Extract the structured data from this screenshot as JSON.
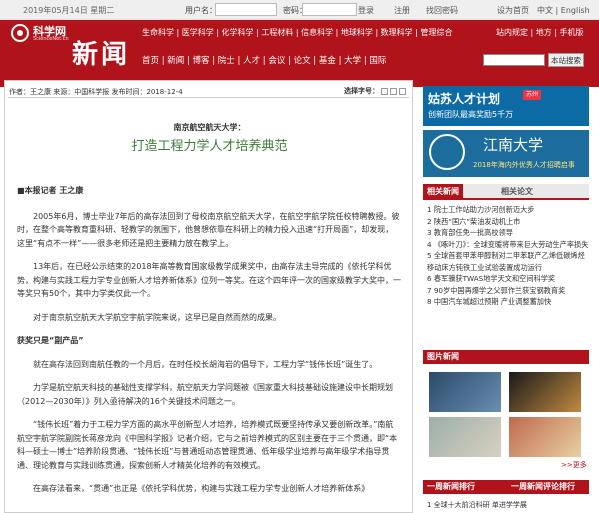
{
  "topbar": {
    "date": "2019年05月14日 星期二",
    "username_label": "用户名：",
    "password_label": "密码：",
    "login": "登录",
    "register": "注册",
    "forgot": "找回密码",
    "set_home": "设为首页",
    "lang": "中文 | English"
  },
  "header": {
    "logo_cn": "科学网",
    "logo_en": "ScienceNet.cn",
    "section": "新闻",
    "nav_top": "生命科学 | 医学科学 | 化学科学 | 工程材料 | 信息科学 | 地球科学 | 数理科学 | 管理综合",
    "nav_top_right": "站内规定 | 地方 | 手机版",
    "nav_sub": "首页 | 新闻 | 博客 | 院士 | 人才 | 会议 | 论文 | 基金 | 大学 | 国际",
    "search_btn": "本站搜索"
  },
  "article": {
    "meta": "作者：王之康 来源：中国科学报 发布时间：2018-12-4",
    "font_select": "选择字号：",
    "subtitle": "南京航空航天大学：",
    "title": "打造工程力学人才培养典范",
    "reporter": "■本报记者 王之康",
    "paragraphs": [
      "2005年6月，博士毕业7年后的高存法回到了母校南京航空航天大学，在航空宇航学院任校特聘教授。彼时，在整个高等教育重科研、轻教学的氛围下，他曾想依靠在科研上的精力投入迅速“打开局面”，却发现，这里“有点不一样”——很多老师还是把主要精力放在教学上。",
      "13年后，在已经公示结束的2018年高等教育国家级教学成果奖中，由高存法主导完成的《依托学科优势，构建与实践工程力学专业创新人才培养新体系》位列一等奖。在这个四年评一次的国家级教学大奖中，一等奖只有50个，其中力学类仅此一个。",
      "对于南京航空航天大学航空宇航学院来说，这早已是自然而然的成果。",
      "获奖只是“副产品”",
      "就在高存法回到南航任教的一个月后，在时任校长胡海岩的倡导下，工程力学“钱伟长班”诞生了。",
      "力学是航空航天科技的基础性支撑学科，航空航天力学问题被《国家重大科技基础设施建设中长期规划（2012—2030年）》列入亟待解决的16个关键技术问题之一。",
      "“钱伟长班”着力于工程力学方面的高水平创新型人才培养，培养模式既要坚持传承又要创新改革。”南航航空宇航学院副院长蒋彦龙向《中国科学报》记者介绍，它与之前培养模式的区别主要在于三个贯通，即“本科—硕士—博士”培养阶段贯通、“钱伟长班”与普通班动态管理贯通、低年级学业培养与高年级学术指导贯通、理论教育与实践训练贯通，探索创新人才精英化培养的有效模式。",
      "在高存法看来，“贯通”也正是《依托学科优势，构建与实践工程力学专业创新人才培养新体系》"
    ]
  },
  "sidebar": {
    "banner1_title": "姑苏人才计划",
    "banner1_badge": "苏州",
    "banner1_sub": "创新团队最高奖励5千万",
    "banner2_title": "江南大学",
    "banner2_sub": "2018年海内外优秀人才招聘启事",
    "tab_related_news": "相关新闻",
    "tab_related_papers": "相关论文",
    "news": [
      "1 院士工作站助力沙河创新迈大步",
      "2 陕西“国六”柴油发动机上市",
      "3 教育部任免一批高校领导",
      "4 《啄叶刀》：全球变暖将带来巨大劳动生产率损失",
      "5 全球首套甲苯甲醇制对二甲苯联产乙烯低碳烯烃移动床方钝铁工业试验装置成功运行",
      "6 春军骥获TWAS地学天文和空间科学奖",
      "7 90岁中国再爆学之父郭作兰获宝钢教育奖",
      "8 中国汽车城超过预期 产业调整蓄加快"
    ],
    "photo_news": "图片新闻",
    "more": ">>更多",
    "rank_week": "一周新闻排行",
    "rank_comment": "一周新闻评论排行",
    "rank_first": "1 全球十大前沿科研 单进学学展"
  }
}
